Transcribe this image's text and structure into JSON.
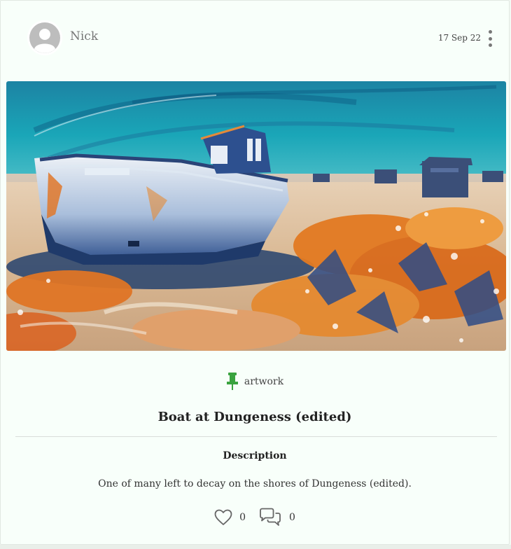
{
  "post": {
    "author": "Nick",
    "date": "17 Sep 22",
    "category": "artwork",
    "title": "Boat at Dungeness (edited)",
    "description_heading": "Description",
    "description": "One of many left to decay on the shores of Dungeness (edited).",
    "like_count": "0",
    "comment_count": "0"
  },
  "icons": {
    "avatar": "user-silhouette-icon",
    "menu": "kebab-menu-icon",
    "category": "pushpin-icon",
    "like": "heart-outline-icon",
    "comment": "speech-bubbles-icon"
  },
  "colors": {
    "background": "#f8fffa",
    "pin": "#3aa33f",
    "text": "#333333",
    "muted": "#777777"
  }
}
